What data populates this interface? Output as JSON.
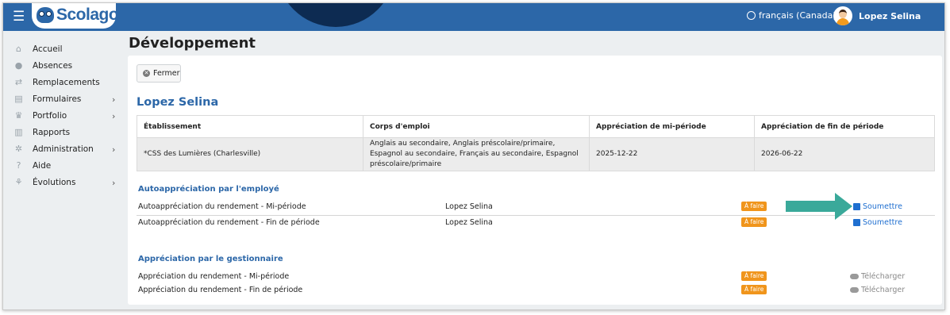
{
  "app": {
    "logo_text": "Scolago",
    "language": "français (Canada)",
    "user_name": "Lopez Selina",
    "brand_color": "#2c67a8",
    "accent_dark": "#0d2b52"
  },
  "sidebar": {
    "items": [
      {
        "label": "Accueil",
        "icon": "home-icon",
        "has_children": false
      },
      {
        "label": "Absences",
        "icon": "users-icon",
        "has_children": false
      },
      {
        "label": "Remplacements",
        "icon": "swap-icon",
        "has_children": false
      },
      {
        "label": "Formulaires",
        "icon": "form-icon",
        "has_children": true
      },
      {
        "label": "Portfolio",
        "icon": "trophy-icon",
        "has_children": true
      },
      {
        "label": "Rapports",
        "icon": "report-icon",
        "has_children": false
      },
      {
        "label": "Administration",
        "icon": "gear-icon",
        "has_children": true
      },
      {
        "label": "Aide",
        "icon": "help-icon",
        "has_children": false
      },
      {
        "label": "Évolutions",
        "icon": "sprout-icon",
        "has_children": true
      }
    ],
    "chevron": "›"
  },
  "main": {
    "page_title": "Développement",
    "close_label": "Fermer",
    "employee_name": "Lopez Selina",
    "table": {
      "headers": [
        "Établissement",
        "Corps d'emploi",
        "Appréciation de mi-période",
        "Appréciation de fin de période"
      ],
      "row": [
        "*CSS des Lumières (Charlesville)",
        "Anglais au secondaire, Anglais préscolaire/primaire, Espagnol au secondaire, Français au secondaire, Espagnol préscolaire/primaire",
        "2025-12-22",
        "2026-06-22"
      ]
    },
    "self_section": {
      "title": "Autoappréciation par l'employé",
      "rows": [
        {
          "name": "Autoappréciation du rendement - Mi-période",
          "employee": "Lopez Selina",
          "status": "À faire",
          "action": "Soumettre"
        },
        {
          "name": "Autoappréciation du rendement - Fin de période",
          "employee": "Lopez Selina",
          "status": "À faire",
          "action": "Soumettre"
        }
      ]
    },
    "manager_section": {
      "title": "Appréciation par le gestionnaire",
      "rows": [
        {
          "name": "Appréciation du rendement - Mi-période",
          "status": "À faire",
          "action": "Télécharger"
        },
        {
          "name": "Appréciation du rendement - Fin de période",
          "status": "À faire",
          "action": "Télécharger"
        }
      ]
    },
    "status_color": "#f0951c",
    "link_color": "#1f6fd0",
    "arrow_color": "#3aa99a"
  }
}
